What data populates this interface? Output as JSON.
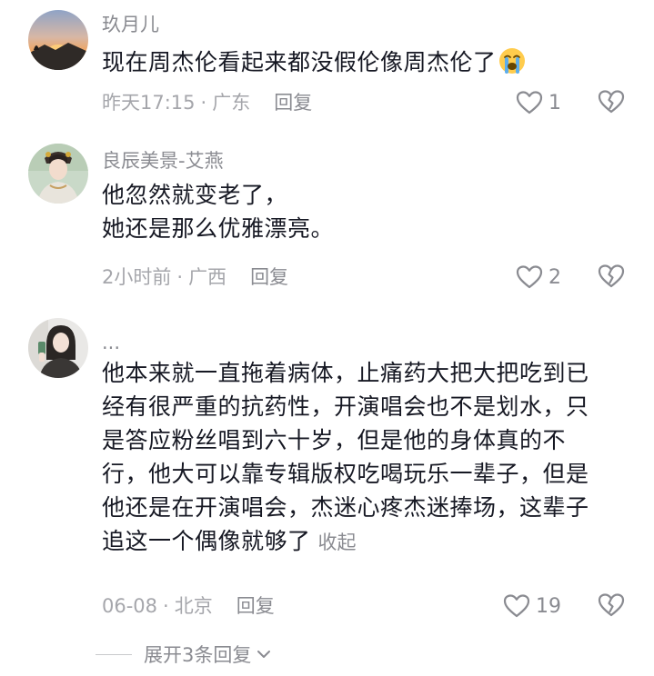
{
  "comments": [
    {
      "username": "玖月儿",
      "lines": [
        "现在周杰伦看起来都没假伦像周杰伦了"
      ],
      "emoji_icon": "loudly-crying-face-icon",
      "time": "昨天17:15",
      "separator": "·",
      "location": "广东",
      "reply_label": "回复",
      "like_count": "1"
    },
    {
      "username": "良辰美景-艾燕",
      "lines": [
        "他忽然就变老了，",
        "她还是那么优雅漂亮。"
      ],
      "time": "2小时前",
      "separator": "·",
      "location": "广西",
      "reply_label": "回复",
      "like_count": "2"
    },
    {
      "username": "...",
      "lines": [
        "他本来就一直拖着病体，止痛药大把大把吃到已",
        "经有很严重的抗药性，开演唱会也不是划水，只",
        "是答应粉丝唱到六十岁，但是他的身体真的不",
        "行，他大可以靠专辑版权吃喝玩乐一辈子，但是",
        "他还是在开演唱会，杰迷心疼杰迷捧场，这辈子",
        "追这一个偶像就够了"
      ],
      "collapse_label": "收起",
      "time": "06-08",
      "separator": "·",
      "location": "北京",
      "reply_label": "回复",
      "like_count": "19"
    }
  ],
  "expand_replies_label": "展开3条回复",
  "colors": {
    "text_primary": "#161823",
    "text_secondary": "#8a8b91",
    "text_tertiary": "#a5a6ab",
    "icon_gray": "#8a8b91"
  }
}
